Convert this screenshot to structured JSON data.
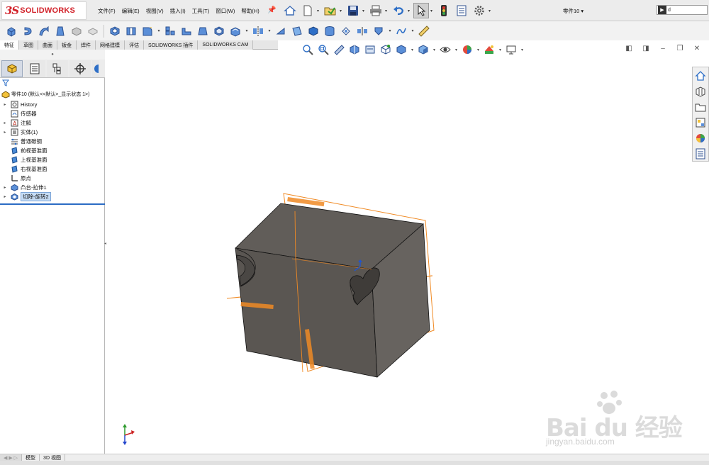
{
  "app": {
    "logo_ds": "3S",
    "logo_word": "SOLIDWORKS",
    "document_title": "零件10 ▾"
  },
  "menu": [
    "文件(F)",
    "编辑(E)",
    "视图(V)",
    "插入(I)",
    "工具(T)",
    "窗口(W)",
    "帮助(H)"
  ],
  "search": {
    "value": "d"
  },
  "tabs": [
    {
      "label": "特征",
      "active": true
    },
    {
      "label": "草图",
      "active": false
    },
    {
      "label": "曲面",
      "active": false
    },
    {
      "label": "钣金",
      "active": false
    },
    {
      "label": "焊件",
      "active": false
    },
    {
      "label": "网格建模",
      "active": false
    },
    {
      "label": "评估",
      "active": false
    },
    {
      "label": "SOLIDWORKS 插件",
      "active": false
    },
    {
      "label": "SOLIDWORKS CAM",
      "active": false
    }
  ],
  "tree": {
    "root_label": "零件10  (默认<<默认>_显示状态 1>)",
    "items": [
      {
        "label": "History",
        "icon": "history-icon",
        "expandable": true
      },
      {
        "label": "传感器",
        "icon": "sensor-icon",
        "expandable": false
      },
      {
        "label": "注解",
        "icon": "annotation-icon",
        "expandable": true
      },
      {
        "label": "实体(1)",
        "icon": "solid-bodies-icon",
        "expandable": true
      },
      {
        "label": "普通碳钢",
        "icon": "material-icon",
        "expandable": false
      },
      {
        "label": "前视基准面",
        "icon": "plane-icon",
        "expandable": false
      },
      {
        "label": "上视基准面",
        "icon": "plane-icon",
        "expandable": false
      },
      {
        "label": "右视基准面",
        "icon": "plane-icon",
        "expandable": false
      },
      {
        "label": "原点",
        "icon": "origin-icon",
        "expandable": false
      },
      {
        "label": "凸台-拉伸1",
        "icon": "extrude-icon",
        "expandable": true
      },
      {
        "label": "切除-旋转2",
        "icon": "revolve-cut-icon",
        "expandable": true,
        "selected": true
      }
    ]
  },
  "view_tabs": [
    {
      "label": "模型"
    },
    {
      "label": "3D 视图"
    }
  ],
  "colors": {
    "body": "#5f5b57",
    "plane": "#f08a24",
    "selection": "#c5dcf5",
    "brand": "#d2222a"
  },
  "watermark": {
    "text": "Bai du 经验",
    "url": "jingyan.baidu.com"
  }
}
